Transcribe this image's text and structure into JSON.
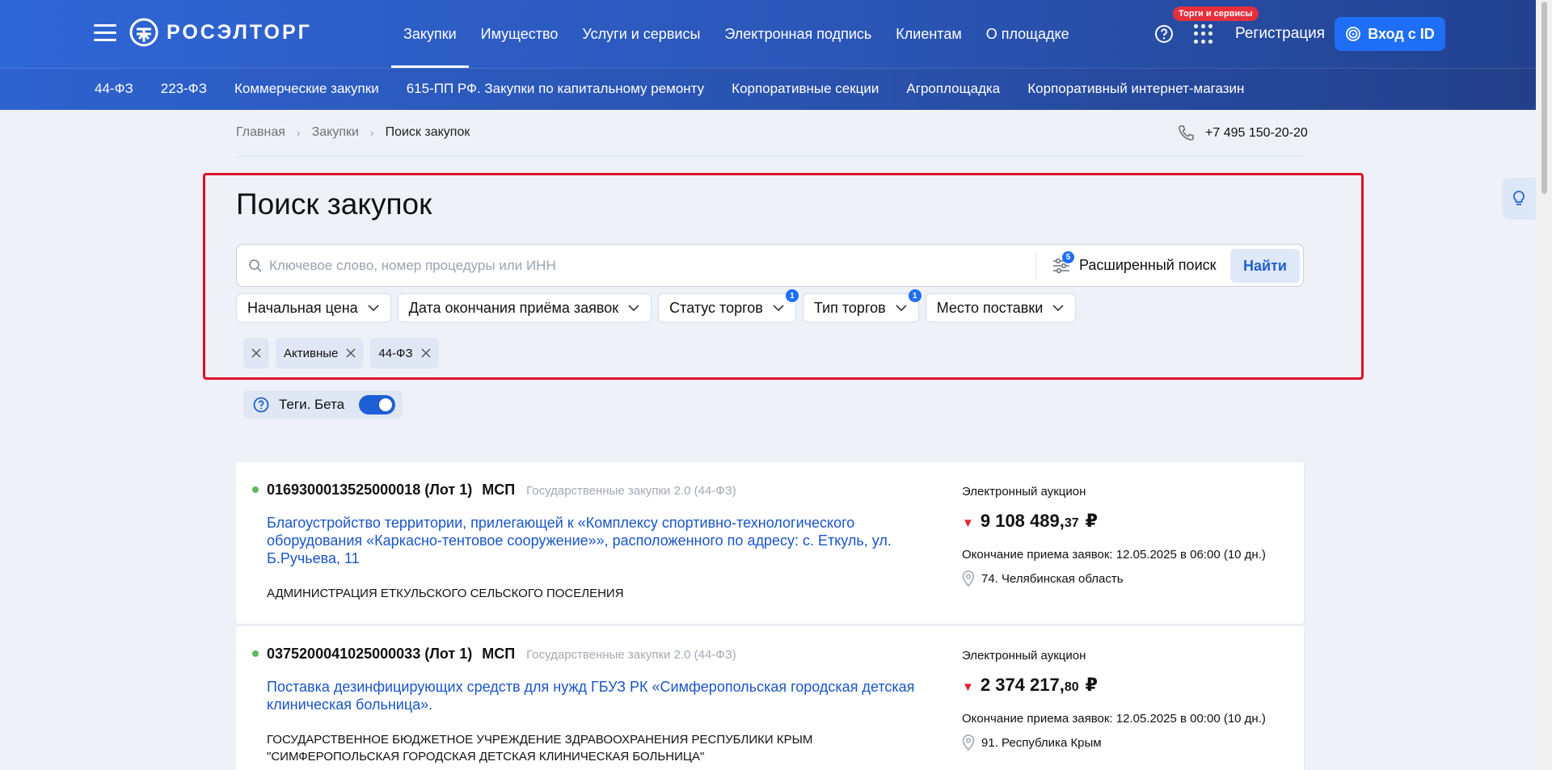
{
  "header": {
    "logo_text": "РОСЭЛТОРГ",
    "nav": [
      "Закупки",
      "Имущество",
      "Услуги и сервисы",
      "Электронная подпись",
      "Клиентам",
      "О площадке"
    ],
    "badge": "Торги и сервисы",
    "register": "Регистрация",
    "login": "Вход с ID"
  },
  "subnav": [
    "44-ФЗ",
    "223-ФЗ",
    "Коммерческие закупки",
    "615-ПП РФ. Закупки по капитальному ремонту",
    "Корпоративные секции",
    "Агроплощадка",
    "Корпоративный интернет-магазин"
  ],
  "breadcrumb": [
    "Главная",
    "Закупки",
    "Поиск закупок"
  ],
  "phone": "+7 495 150-20-20",
  "page_title": "Поиск закупок",
  "search": {
    "placeholder": "Ключевое слово, номер процедуры или ИНН",
    "advanced_label": "Расширенный поиск",
    "advanced_count": "5",
    "find_label": "Найти"
  },
  "filters": [
    {
      "label": "Начальная цена",
      "badge": ""
    },
    {
      "label": "Дата окончания приёма заявок",
      "badge": ""
    },
    {
      "label": "Статус торгов",
      "badge": "1"
    },
    {
      "label": "Тип торгов",
      "badge": "1"
    },
    {
      "label": "Место поставки",
      "badge": ""
    }
  ],
  "chips": [
    "Активные",
    "44-ФЗ"
  ],
  "tags": {
    "label": "Теги. Бета",
    "enabled": true
  },
  "results": [
    {
      "number": "0169300013525000018 (Лот 1)",
      "msp": "МСП",
      "law": "Государственные закупки 2.0 (44-ФЗ)",
      "title": "Благоустройство территории, прилегающей к «Комплексу спортивно-технологического оборудования «Каркасно-тентовое сооружение»», расположенного по адресу: с. Еткуль, ул. Б.Ручьева, 11",
      "org": "АДМИНИСТРАЦИЯ ЕТКУЛЬСКОГО СЕЛЬСКОГО ПОСЕЛЕНИЯ",
      "type": "Электронный аукцион",
      "price_main": "9 108 489,",
      "price_kop": "37",
      "currency": "₽",
      "deadline": "Окончание приема заявок: 12.05.2025 в 06:00 (10 дн.)",
      "region": "74. Челябинская область"
    },
    {
      "number": "0375200041025000033 (Лот 1)",
      "msp": "МСП",
      "law": "Государственные закупки 2.0 (44-ФЗ)",
      "title": "Поставка дезинфицирующих средств для нужд ГБУЗ РК «Симферопольская городская детская клиническая больница».",
      "org": "ГОСУДАРСТВЕННОЕ БЮДЖЕТНОЕ УЧРЕЖДЕНИЕ ЗДРАВООХРАНЕНИЯ РЕСПУБЛИКИ КРЫМ \"СИМФЕРОПОЛЬСКАЯ ГОРОДСКАЯ ДЕТСКАЯ КЛИНИЧЕСКАЯ БОЛЬНИЦА\"",
      "type": "Электронный аукцион",
      "price_main": "2 374 217,",
      "price_kop": "80",
      "currency": "₽",
      "deadline": "Окончание приема заявок: 12.05.2025 в 00:00 (10 дн.)",
      "region": "91. Республика Крым"
    }
  ],
  "colors": {
    "accent": "#1e6ef6",
    "header": "#2b56b7",
    "highlight": "#e0102a",
    "link": "#1a55c7"
  }
}
